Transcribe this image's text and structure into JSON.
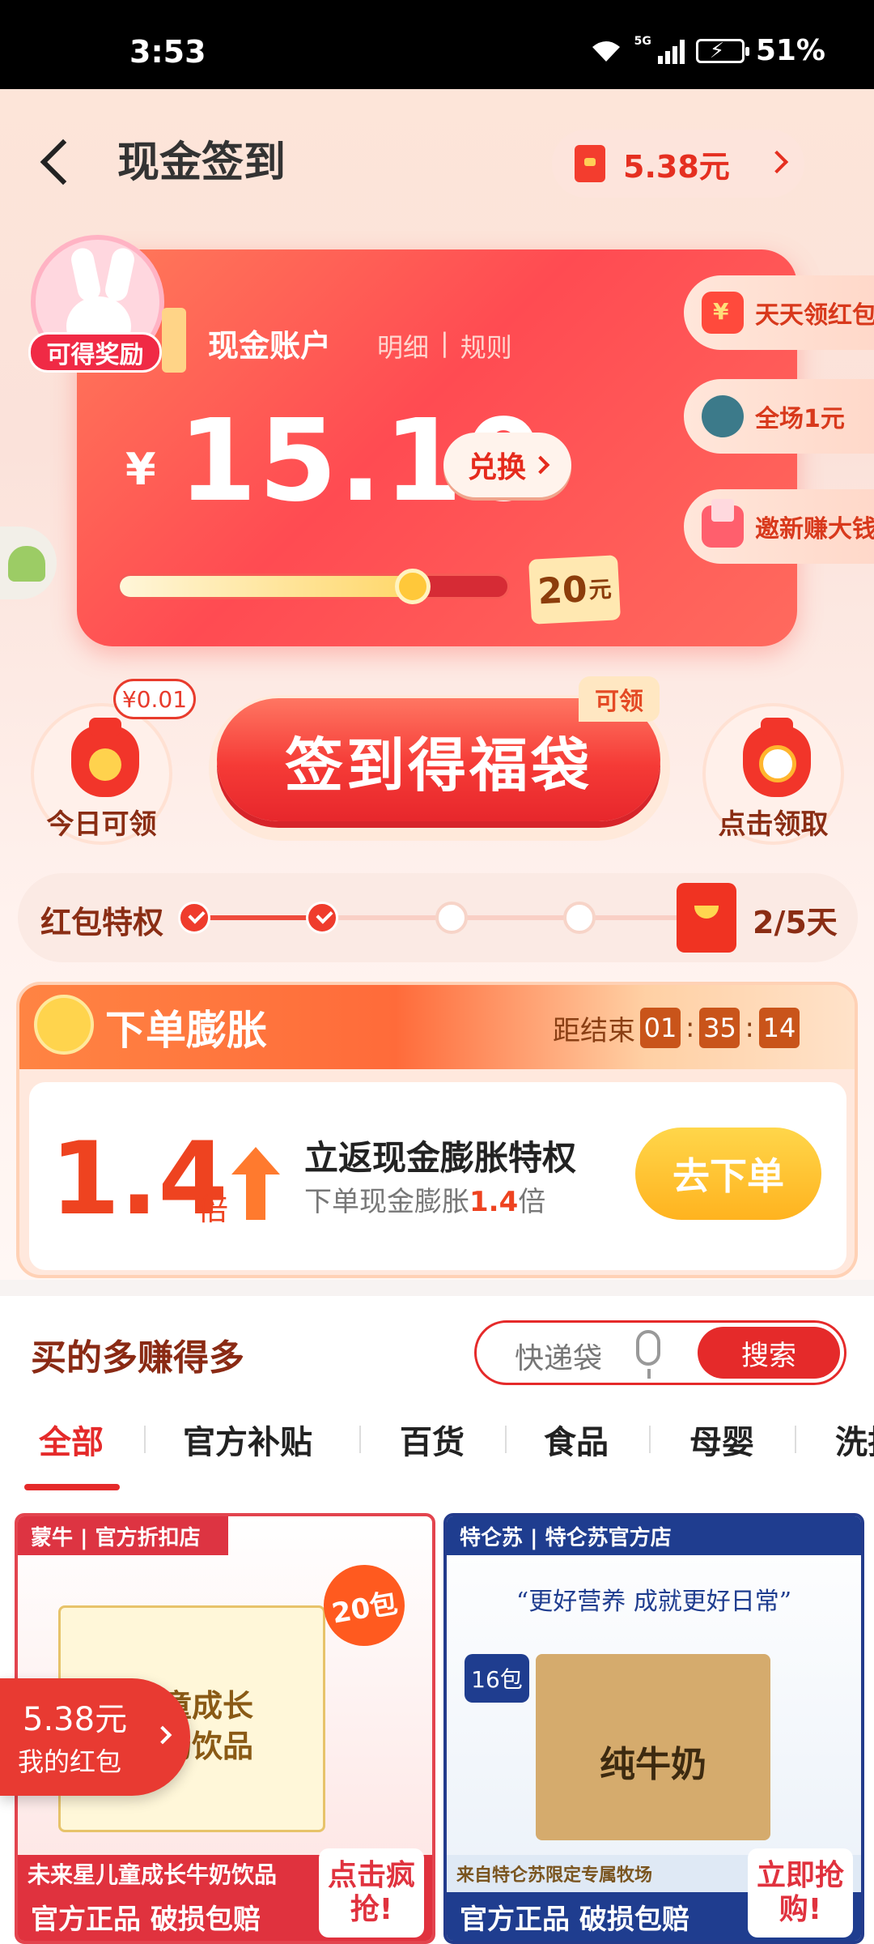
{
  "status_bar": {
    "time": "3:53",
    "network": "5G",
    "battery": "51%"
  },
  "header": {
    "title": "现金签到",
    "wallet_amount": "5.38元"
  },
  "cash_card": {
    "badge_label": "可得奖励",
    "account_label": "现金账户",
    "link_detail": "明细",
    "link_sep": "|",
    "link_rules": "规则",
    "currency": "¥",
    "amount": "15.10",
    "exchange_label": "兑换",
    "progress_fraction": 0.755,
    "target_value": "20",
    "target_unit": "元"
  },
  "side_tasks": [
    {
      "label": "天天领红包",
      "icon": "red-envelope-icon"
    },
    {
      "label": "全场1元",
      "icon": "gift-icon"
    },
    {
      "label": "邀新赚大钱",
      "icon": "invite-envelope-icon"
    }
  ],
  "sign_in": {
    "today_price": "¥0.01",
    "today_label": "今日可领",
    "button_label": "签到得福袋",
    "claim_tag": "可领",
    "right_label": "点击领取"
  },
  "privilege": {
    "label": "红包特权",
    "steps_done": 2,
    "steps_total": 5,
    "count_label": "2/5天"
  },
  "inflate": {
    "title": "下单膨胀",
    "countdown_label": "距结束",
    "hours": "01",
    "colon": ":",
    "minutes": "35",
    "seconds": "14",
    "multiplier": "1.4",
    "multiplier_unit": "倍",
    "main_text": "立返现金膨胀特权",
    "sub_prefix": "下单现金膨胀",
    "sub_value": "1.4",
    "sub_suffix": "倍",
    "button_label": "去下单"
  },
  "earn_section": {
    "title": "买的多赚得多",
    "search_placeholder": "快递袋",
    "search_button": "搜索"
  },
  "category_tabs": [
    "全部",
    "官方补贴",
    "百货",
    "食品",
    "母婴",
    "洗护"
  ],
  "products": [
    {
      "store": "蒙牛 | 官方折扣店",
      "box_line1": "儿童成长",
      "box_line2": "牛奶饮品",
      "pack_badge": "20包",
      "name": "未来星儿童成长牛奶饮品",
      "tag": "官方正品 破损包赔",
      "action": "点击疯抢!"
    },
    {
      "store": "特仑苏 | 特仑苏官方店",
      "slogan": "“更好营养 成就更好日常”",
      "pack_badge": "16包",
      "box_text": "纯牛奶",
      "name": "来自特仑苏限定专属牧场",
      "tag": "官方正品 破损包赔",
      "action": "立即抢购!"
    }
  ],
  "floating_envelope": {
    "amount": "5.38元",
    "label": "我的红包"
  },
  "colors": {
    "primary_red": "#e52a2a",
    "gold": "#ffc83a",
    "brown_text": "#8a2d14"
  }
}
